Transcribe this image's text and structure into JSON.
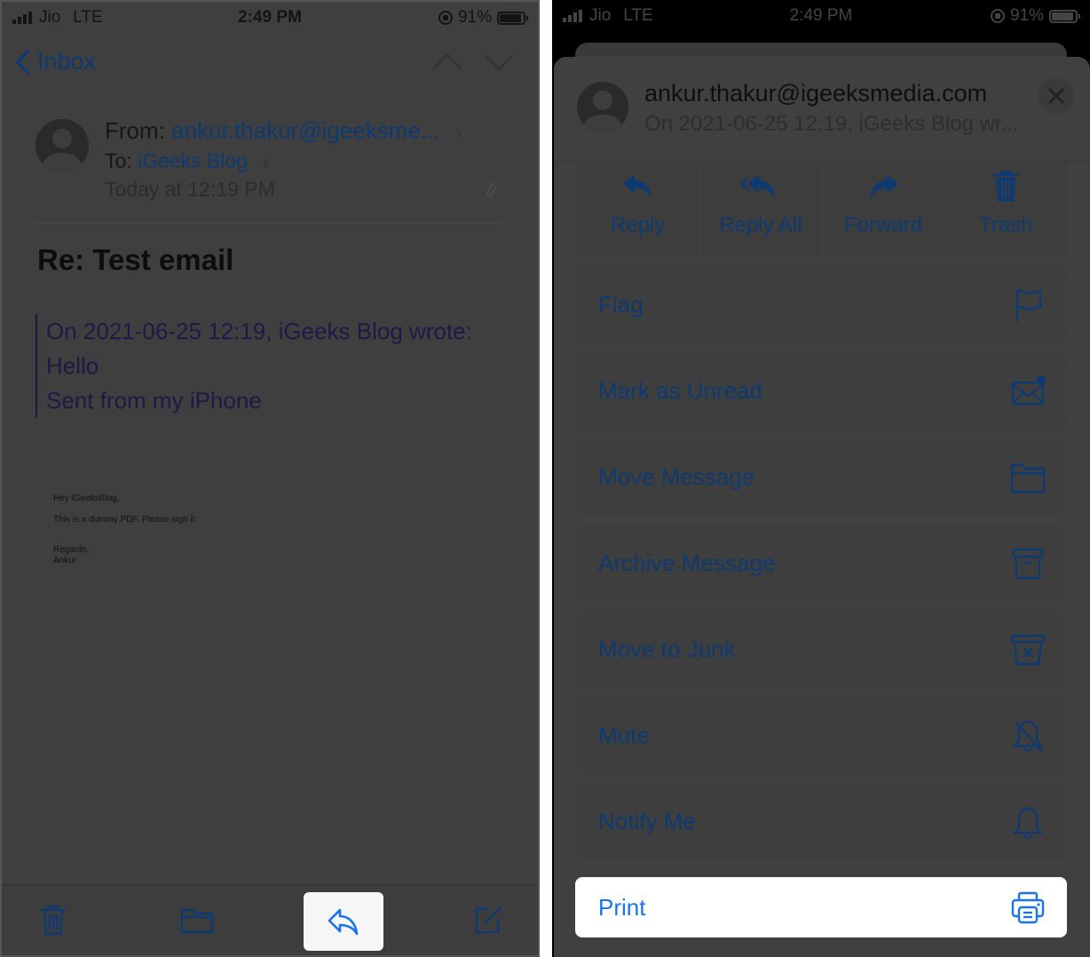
{
  "colors": {
    "accent": "#1a73e8",
    "dimmed_accent": "#0e3a72",
    "overlay_bg": "#3f3f3f",
    "highlight_bg": "#ffffff"
  },
  "status_bar": {
    "carrier": "Jio",
    "network": "LTE",
    "time": "2:49 PM",
    "battery": "91%",
    "battery_level": 0.91
  },
  "left_screen": {
    "nav": {
      "back_label": "Inbox",
      "back_icon": "chevron-left-icon",
      "prev_icon": "chevron-up-icon",
      "next_icon": "chevron-down-icon"
    },
    "header": {
      "from_label": "From:",
      "from_value": "ankur.thakur@igeeksme...",
      "to_label": "To:",
      "to_value": "iGeeks Blog",
      "date": "Today at 12:19 PM"
    },
    "subject": "Re: Test email",
    "quote": {
      "line1": "On 2021-06-25 12:19, iGeeks Blog wrote:",
      "line2": "Hello",
      "line3": "Sent from my iPhone"
    },
    "pdf_preview": {
      "greeting": "Hey iGeeksBlog,",
      "body": "This is a dummy PDF. Please sign it.",
      "closing": "Regards,",
      "signature": "Ankur"
    },
    "toolbar": [
      {
        "name": "trash",
        "icon": "trash-icon"
      },
      {
        "name": "folder",
        "icon": "folder-icon"
      },
      {
        "name": "reply",
        "icon": "reply-icon",
        "highlighted": true
      },
      {
        "name": "compose",
        "icon": "compose-icon"
      }
    ]
  },
  "right_screen": {
    "sheet_header": {
      "email": "ankur.thakur@igeeksmedia.com",
      "preview": "On 2021-06-25 12:19, iGeeks Blog wr..."
    },
    "quick_actions": [
      {
        "label": "Reply",
        "icon": "reply-icon"
      },
      {
        "label": "Reply All",
        "icon": "reply-all-icon"
      },
      {
        "label": "Forward",
        "icon": "forward-icon"
      },
      {
        "label": "Trash",
        "icon": "trash-icon"
      }
    ],
    "actions": [
      {
        "label": "Flag",
        "icon": "flag-icon"
      },
      {
        "label": "Mark as Unread",
        "icon": "unread-envelope-icon"
      },
      {
        "label": "Move Message",
        "icon": "folder-icon"
      },
      {
        "label": "Archive Message",
        "icon": "archive-box-icon"
      },
      {
        "label": "Move to Junk",
        "icon": "junk-box-icon"
      },
      {
        "label": "Mute",
        "icon": "bell-slash-icon"
      },
      {
        "label": "Notify Me",
        "icon": "bell-icon"
      }
    ],
    "print": {
      "label": "Print",
      "icon": "printer-icon",
      "highlighted": true
    }
  }
}
